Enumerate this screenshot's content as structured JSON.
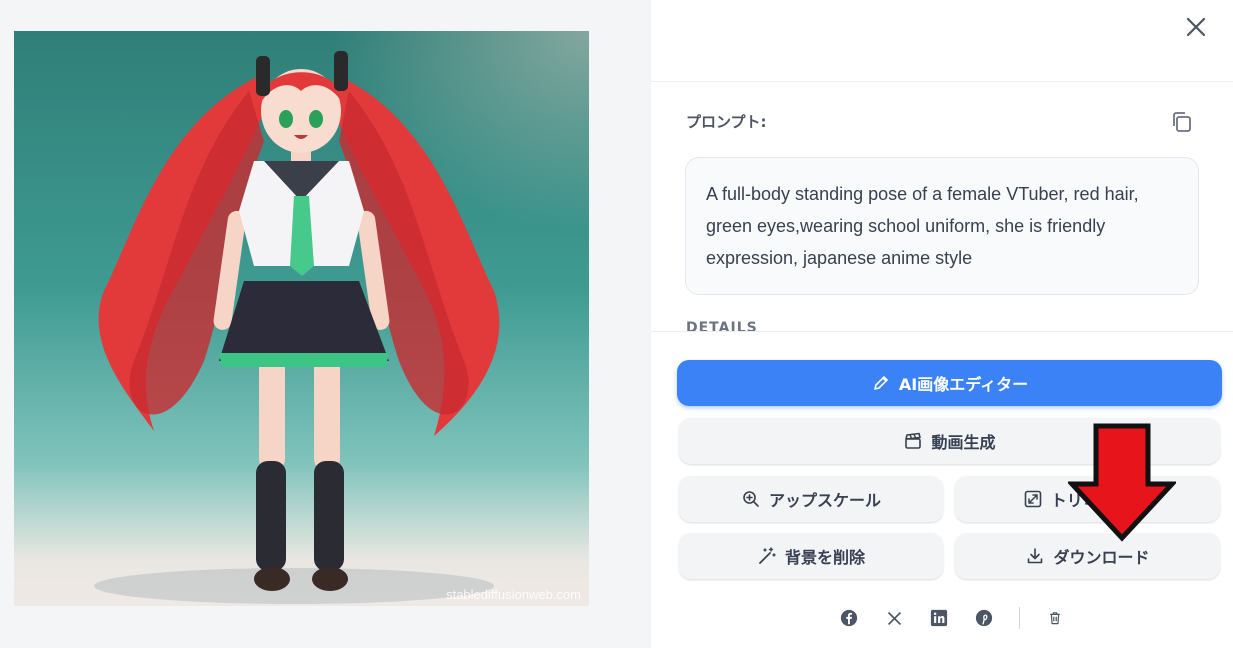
{
  "image": {
    "watermark": "stablediffusionweb.com"
  },
  "panel": {
    "prompt_label": "プロンプト:",
    "prompt_text": "A full-body standing pose of a female VTuber, red hair, green eyes,wearing school uniform, she is friendly expression, japanese anime style",
    "details_label": "DETAILS"
  },
  "buttons": {
    "ai_editor": "AI画像エディター",
    "video": "動画生成",
    "upscale": "アップスケール",
    "trim": "トリミン  拡張",
    "remove_bg": "背景を削除",
    "download": "ダウンロード"
  },
  "socials": [
    "facebook-icon",
    "x-icon",
    "linkedin-icon",
    "pinterest-icon",
    "trash-icon"
  ],
  "colors": {
    "primary": "#3b82f6",
    "arrow": "#e8141c"
  }
}
